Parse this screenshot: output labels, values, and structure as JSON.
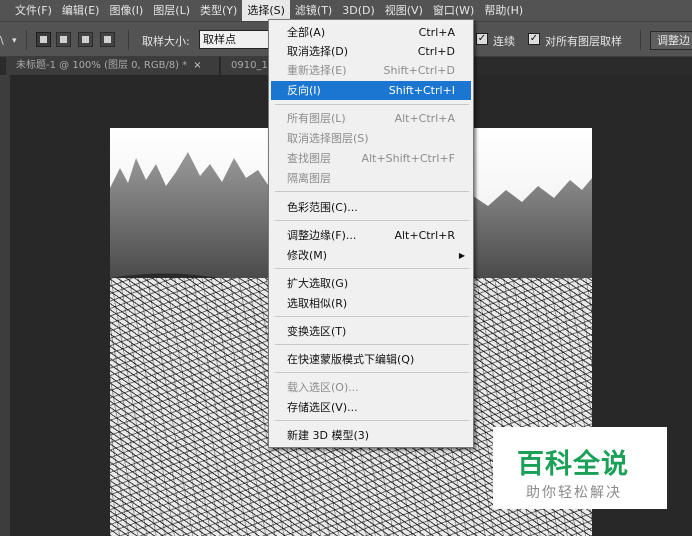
{
  "menubar": {
    "items": [
      "文件(F)",
      "编辑(E)",
      "图像(I)",
      "图层(L)",
      "类型(Y)",
      "选择(S)",
      "滤镜(T)",
      "3D(D)",
      "视图(V)",
      "窗口(W)",
      "帮助(H)"
    ],
    "active_index": 5
  },
  "options": {
    "sample_size_label": "取样大小:",
    "sample_size_value": "取样点",
    "contiguous_label": "连续",
    "all_layers_label": "对所有图层取样",
    "adjust_edge_button": "调整边",
    "checkmark": "✓"
  },
  "tabs": [
    {
      "label": "未标题-1 @ 100% (图层 0, RGB/8) *",
      "close": "×"
    },
    {
      "label": "0910_1"
    }
  ],
  "menu": {
    "items": [
      {
        "label": "全部(A)",
        "shortcut": "Ctrl+A",
        "state": "normal"
      },
      {
        "label": "取消选择(D)",
        "shortcut": "Ctrl+D",
        "state": "normal"
      },
      {
        "label": "重新选择(E)",
        "shortcut": "Shift+Ctrl+D",
        "state": "disabled"
      },
      {
        "label": "反向(I)",
        "shortcut": "Shift+Ctrl+I",
        "state": "highlighted"
      },
      {
        "label": "所有图层(L)",
        "shortcut": "Alt+Ctrl+A",
        "state": "disabled"
      },
      {
        "label": "取消选择图层(S)",
        "shortcut": "",
        "state": "disabled"
      },
      {
        "label": "查找图层",
        "shortcut": "Alt+Shift+Ctrl+F",
        "state": "disabled"
      },
      {
        "label": "隔离图层",
        "shortcut": "",
        "state": "disabled"
      },
      {
        "label": "色彩范围(C)...",
        "shortcut": "",
        "state": "normal"
      },
      {
        "label": "调整边缘(F)...",
        "shortcut": "Alt+Ctrl+R",
        "state": "normal"
      },
      {
        "label": "修改(M)",
        "shortcut": "",
        "state": "submenu"
      },
      {
        "label": "扩大选取(G)",
        "shortcut": "",
        "state": "normal"
      },
      {
        "label": "选取相似(R)",
        "shortcut": "",
        "state": "normal"
      },
      {
        "label": "变换选区(T)",
        "shortcut": "",
        "state": "normal"
      },
      {
        "label": "在快速蒙版模式下编辑(Q)",
        "shortcut": "",
        "state": "normal"
      },
      {
        "label": "载入选区(O)...",
        "shortcut": "",
        "state": "disabled"
      },
      {
        "label": "存储选区(V)...",
        "shortcut": "",
        "state": "normal"
      },
      {
        "label": "新建 3D 模型(3)",
        "shortcut": "",
        "state": "normal"
      }
    ],
    "submenu_arrow": "▶"
  },
  "watermark": {
    "title": "百科全说",
    "subtitle": "助你轻松解决"
  },
  "colors": {
    "menubar": "#535353",
    "highlight": "#1b76d2",
    "watermark_green": "#1aa057"
  }
}
